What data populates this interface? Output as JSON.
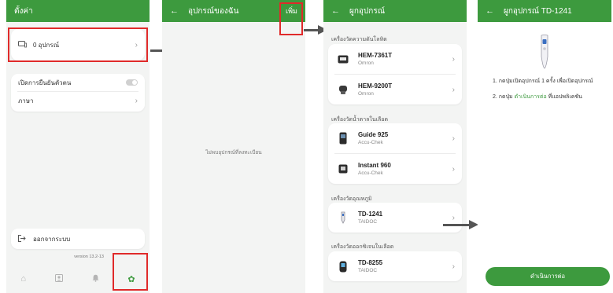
{
  "screen1": {
    "title": "ตั้งค่า",
    "devices_label": "0 อุปกรณ์",
    "biometric_label": "เปิดการยืนยันตัวตน",
    "language_label": "ภาษา",
    "logout_label": "ออกจากระบบ",
    "version": "version 13.2-13",
    "icons": [
      "device-icon",
      "chevron-right-icon",
      "toggle-switch",
      "logout-icon",
      "home-icon",
      "profile-icon",
      "bell-icon",
      "gear-icon"
    ]
  },
  "screen2": {
    "title": "อุปกรณ์ของฉัน",
    "add_label": "เพิ่ม",
    "empty_text": "ไม่พบอุปกรณ์ที่ลงทะเบียน"
  },
  "screen3": {
    "title": "ผูกอุปกรณ์",
    "sections": [
      {
        "label": "เครื่องวัดความดันโลหิต",
        "devices": [
          {
            "name": "HEM-7361T",
            "brand": "Omron"
          },
          {
            "name": "HEM-9200T",
            "brand": "Omron"
          }
        ]
      },
      {
        "label": "เครื่องวัดน้ำตาลในเลือด",
        "devices": [
          {
            "name": "Guide 925",
            "brand": "Accu-Chek"
          },
          {
            "name": "Instant 960",
            "brand": "Accu-Chek"
          }
        ]
      },
      {
        "label": "เครื่องวัดอุณหภูมิ",
        "devices": [
          {
            "name": "TD-1241",
            "brand": "TAIDOC"
          }
        ]
      },
      {
        "label": "เครื่องวัดออกซิเจนในเลือด",
        "devices": [
          {
            "name": "TD-8255",
            "brand": "TAIDOC"
          }
        ]
      }
    ]
  },
  "screen4": {
    "title": "ผูกอุปกรณ์ TD-1241",
    "step1": "1. กดปุ่มเปิดอุปกรณ์ 1 ครั้ง เพื่อเปิดอุปกรณ์",
    "step2_prefix": "2. กดปุ่ม ",
    "step2_link": "ดำเนินการต่อ",
    "step2_suffix": " ที่แอปพลิเคชัน",
    "continue_label": "ดำเนินการต่อ"
  },
  "colors": {
    "brand_green": "#3d9a3e",
    "highlight_red": "#e02a2a",
    "arrow_gray": "#555555"
  }
}
